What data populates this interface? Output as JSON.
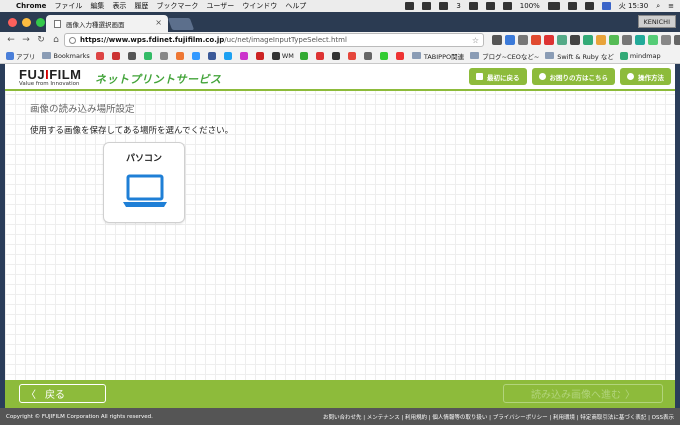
{
  "menubar": {
    "app": "Chrome",
    "items": [
      "ファイル",
      "編集",
      "表示",
      "履歴",
      "ブックマーク",
      "ユーザー",
      "ウインドウ",
      "ヘルプ"
    ],
    "badge_count": "3",
    "battery": "100%",
    "clock": "火 15:30"
  },
  "browser": {
    "tab_title": "画像入力種選択画面",
    "user": "KENICHI",
    "url_host": "https://www.wps.fdinet.fujifilm.co.jp",
    "url_path": "/uc/net/imageInputTypeSelect.html",
    "bookmarks": {
      "apps": "アプリ",
      "bookmarks": "Bookmarks",
      "wm": "WM",
      "tabippo": "TABIPPO関連",
      "blog": "ブログ~CEOなど~",
      "swift": "Swift & Ruby など",
      "mindmap": "mindmap"
    }
  },
  "site": {
    "brand_prefix": "FUJ",
    "brand_i": "I",
    "brand_suffix": "FILM",
    "tagline": "Value from Innovation",
    "service_name": "ネットプリントサービス",
    "nav": {
      "home": "最初に戻る",
      "help": "お困りの方はこちら",
      "howto": "操作方法"
    },
    "heading": "画像の読み込み場所設定",
    "instruction": "使用する画像を保存してある場所を選んでください。",
    "option_pc": "パソコン",
    "back_chevron": "〈",
    "back_label": "戻る",
    "next_label": "読み込み画像へ進む",
    "next_chevron": "〉",
    "copyright": "Copyright © FUJIFILM Corporation All rights reserved.",
    "footer_links": "お問い合わせ先 | メンテナンス | 利用規約 | 個人情報等の取り扱い | プライバシーポリシー | 利用環境 | 特定商取引法に基づく表記 | OSS表示"
  },
  "colors": {
    "accent_green": "#8dbb3b",
    "service_green": "#43a43a",
    "laptop_blue": "#1f7fd6"
  }
}
